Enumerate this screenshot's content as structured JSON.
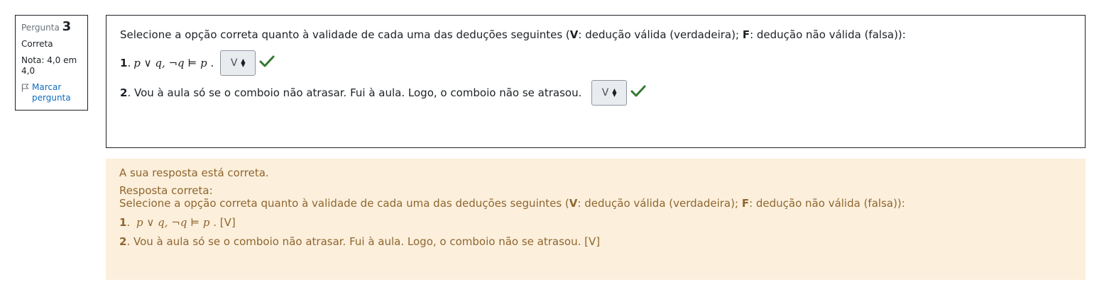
{
  "info": {
    "question_label": "Pergunta",
    "question_number": "3",
    "state": "Correta",
    "grade": "Nota: 4,0 em 4,0",
    "flag_label": "Marcar pergunta"
  },
  "question": {
    "intro_prefix": "Selecione a opção correta quanto à validade de cada uma das deduções seguintes (",
    "v_letter": "V",
    "v_desc": ": dedução válida (verdadeira); ",
    "f_letter": "F",
    "f_desc": ": dedução não válida (falsa)):",
    "items": [
      {
        "number": "1",
        "text": "p ∨ q,  ¬q  ⊨  p .",
        "selected": "V"
      },
      {
        "number": "2",
        "text": " Vou à aula só se o comboio não atrasar. Fui à aula. Logo, o comboio não se atrasou. ",
        "selected": "V"
      }
    ],
    "check_color": "#357a32"
  },
  "feedback": {
    "result": "A sua resposta está correta.",
    "correct_label": "Resposta correta:",
    "item1_answer": "[V]",
    "item2_answer": "[V]"
  }
}
